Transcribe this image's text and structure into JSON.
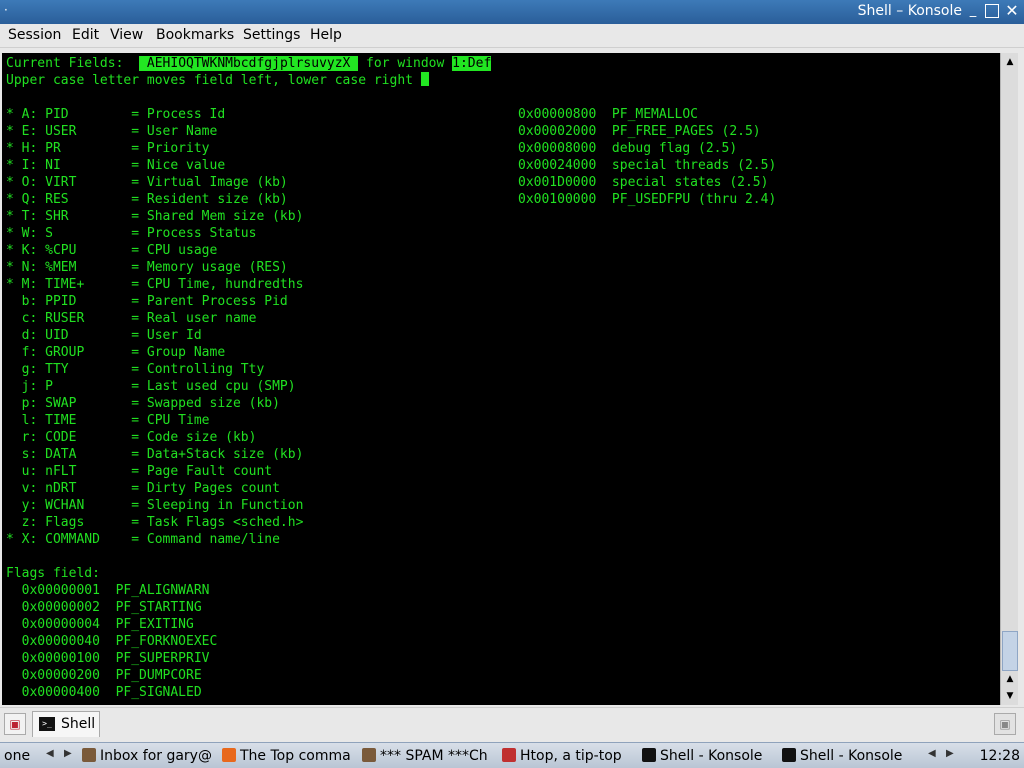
{
  "window": {
    "title": "Shell – Konsole",
    "menu": [
      "Session",
      "Edit",
      "View",
      "Bookmarks",
      "Settings",
      "Help"
    ]
  },
  "terminal": {
    "header_prefix": "Current Fields:  ",
    "fields_string": " AEHIOQTWKNMbcdfgjplrsuvyzX ",
    "header_mid": " for window ",
    "window_name": "1:Def",
    "hint": "Upper case letter moves field left, lower case right ",
    "fields": [
      "* A: PID        = Process Id",
      "* E: USER       = User Name",
      "* H: PR         = Priority",
      "* I: NI         = Nice value",
      "* O: VIRT       = Virtual Image (kb)",
      "* Q: RES        = Resident size (kb)",
      "* T: SHR        = Shared Mem size (kb)",
      "* W: S          = Process Status",
      "* K: %CPU       = CPU usage",
      "* N: %MEM       = Memory usage (RES)",
      "* M: TIME+      = CPU Time, hundredths",
      "  b: PPID       = Parent Process Pid",
      "  c: RUSER      = Real user name",
      "  d: UID        = User Id",
      "  f: GROUP      = Group Name",
      "  g: TTY        = Controlling Tty",
      "  j: P          = Last used cpu (SMP)",
      "  p: SWAP       = Swapped size (kb)",
      "  l: TIME       = CPU Time",
      "  r: CODE       = Code size (kb)",
      "  s: DATA       = Data+Stack size (kb)",
      "  u: nFLT       = Page Fault count",
      "  v: nDRT       = Dirty Pages count",
      "  y: WCHAN      = Sleeping in Function",
      "  z: Flags      = Task Flags <sched.h>",
      "* X: COMMAND    = Command name/line"
    ],
    "flags_title": "Flags field:",
    "flags": [
      "  0x00000001  PF_ALIGNWARN",
      "  0x00000002  PF_STARTING",
      "  0x00000004  PF_EXITING",
      "  0x00000040  PF_FORKNOEXEC",
      "  0x00000100  PF_SUPERPRIV",
      "  0x00000200  PF_DUMPCORE",
      "  0x00000400  PF_SIGNALED"
    ],
    "flags_right": [
      "0x00000800  PF_MEMALLOC",
      "0x00002000  PF_FREE_PAGES (2.5)",
      "0x00008000  debug flag (2.5)",
      "0x00024000  special threads (2.5)",
      "0x001D0000  special states (2.5)",
      "0x00100000  PF_USEDFPU (thru 2.4)"
    ]
  },
  "tabs": [
    {
      "label": "Shell"
    }
  ],
  "taskbar": {
    "left_label": "one",
    "tasks": [
      {
        "label": "Inbox for gary@",
        "icon_color": "#7a5a3a"
      },
      {
        "label": "The Top comma",
        "icon_color": "#e8681c"
      },
      {
        "label": "*** SPAM ***Ch",
        "icon_color": "#7a5a3a"
      },
      {
        "label": "Htop, a tip-top",
        "icon_color": "#c03030"
      },
      {
        "label": "Shell - Konsole",
        "icon_color": "#111111"
      },
      {
        "label": "Shell - Konsole",
        "icon_color": "#111111"
      }
    ],
    "clock": "12:28"
  },
  "colors": {
    "term_fg": "#21e021",
    "term_bg": "#000000",
    "title_bg": "#2a5e99"
  }
}
